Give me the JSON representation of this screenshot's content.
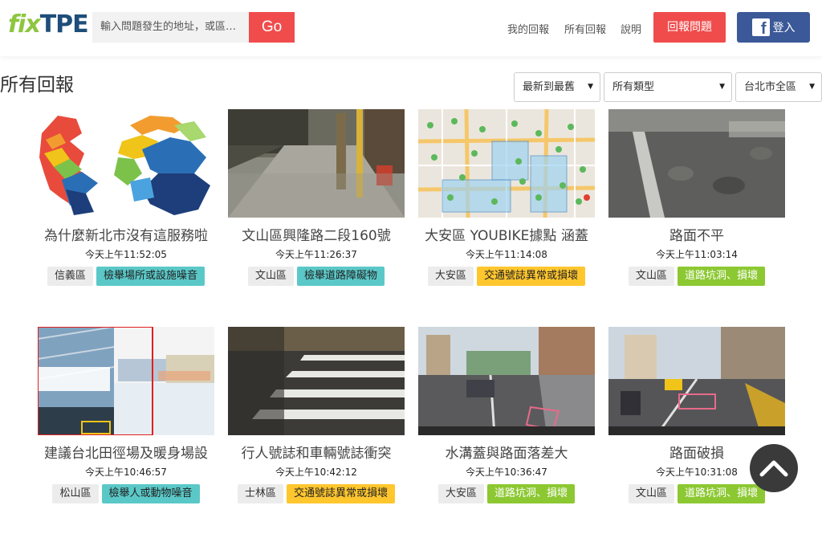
{
  "header": {
    "logo_fix": "fix",
    "logo_tpe": "TPE",
    "search_placeholder": "輸入問題發生的地址，或區域...",
    "go_label": "Go",
    "nav": [
      "我的回報",
      "所有回報",
      "說明"
    ],
    "report_button": "回報問題",
    "login_button": "登入",
    "facebook_glyph": "f"
  },
  "page": {
    "title": "所有回報",
    "filters": {
      "sort": "最新到最舊",
      "type": "所有類型",
      "area": "台北市全區"
    }
  },
  "reports": [
    {
      "title": "為什麼新北市沒有這服務啦",
      "time": "今天上午11:52:05",
      "area": "信義區",
      "category": "檢舉場所或設施噪音",
      "category_color": "cyan",
      "thumb": "map-districts"
    },
    {
      "title": "文山區興隆路二段160號",
      "time": "今天上午11:26:37",
      "area": "文山區",
      "category": "檢舉道路障礙物",
      "category_color": "cyan",
      "thumb": "street-photo"
    },
    {
      "title": "大安區 YOUBIKE據點 涵蓋",
      "time": "今天上午11:14:08",
      "area": "大安區",
      "category": "交通號誌異常或損壞",
      "category_color": "yellow",
      "thumb": "city-map"
    },
    {
      "title": "路面不平",
      "time": "今天上午11:03:14",
      "area": "文山區",
      "category": "道路坑洞、損壞",
      "category_color": "green",
      "thumb": "road-surface"
    },
    {
      "title": "建議台北田徑場及暖身場設",
      "time": "今天上午10:46:57",
      "area": "松山區",
      "category": "檢舉人或動物噪音",
      "category_color": "cyan",
      "thumb": "stadium-photo"
    },
    {
      "title": "行人號誌和車輛號誌衝突",
      "time": "今天上午10:42:12",
      "area": "士林區",
      "category": "交通號誌異常或損壞",
      "category_color": "yellow",
      "thumb": "crosswalk"
    },
    {
      "title": "水溝蓋與路面落差大",
      "time": "今天上午10:36:47",
      "area": "大安區",
      "category": "道路坑洞、損壞",
      "category_color": "green",
      "thumb": "dashcam-1"
    },
    {
      "title": "路面破損",
      "time": "今天上午10:31:08",
      "area": "文山區",
      "category": "道路坑洞、損壞",
      "category_color": "green",
      "thumb": "dashcam-2"
    }
  ],
  "colors": {
    "brand_green": "#8dc63f",
    "brand_blue": "#1e4e79",
    "accent_red": "#f04c4c",
    "facebook_blue": "#3b5998",
    "tag_cyan": "#5bc8c8",
    "tag_yellow": "#ffc62e",
    "tag_green": "#8cc832"
  },
  "back_to_top_icon": "chevron-up-icon"
}
